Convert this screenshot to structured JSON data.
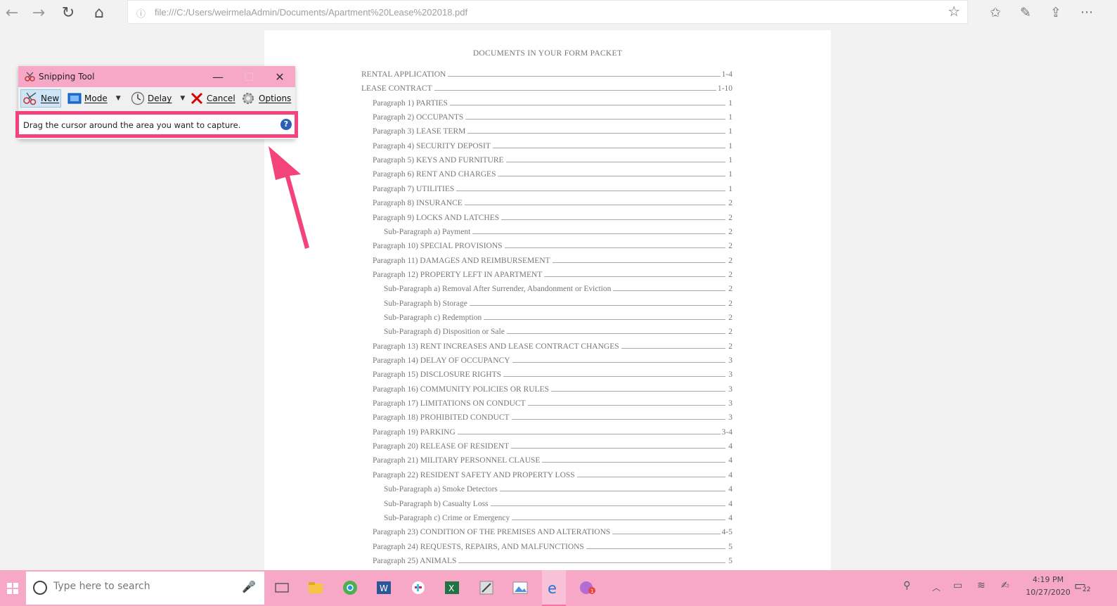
{
  "browser": {
    "back_icon": "←",
    "forward_icon": "→",
    "refresh_icon": "↻",
    "home_icon": "⌂",
    "info_icon": "ⓘ",
    "url": "file:///C:/Users/weirmelaAdmin/Documents/Apartment%20Lease%202018.pdf",
    "favorite_icon": "☆",
    "favorites_icon": "✩",
    "pen_icon": "✎",
    "share_icon": "⇪",
    "more_icon": "···"
  },
  "pdf": {
    "title": "DOCUMENTS IN YOUR FORM PACKET",
    "toc": [
      {
        "label": "RENTAL APPLICATION",
        "page": "1-4",
        "level": 0
      },
      {
        "label": "LEASE CONTRACT",
        "page": "1-10",
        "level": 0
      },
      {
        "label": "Paragraph 1) PARTIES",
        "page": "1",
        "level": 1
      },
      {
        "label": "Paragraph 2) OCCUPANTS",
        "page": "1",
        "level": 1
      },
      {
        "label": "Paragraph 3) LEASE TERM",
        "page": "1",
        "level": 1
      },
      {
        "label": "Paragraph 4) SECURITY DEPOSIT",
        "page": "1",
        "level": 1
      },
      {
        "label": "Paragraph 5) KEYS AND FURNITURE",
        "page": "1",
        "level": 1
      },
      {
        "label": "Paragraph 6) RENT AND CHARGES",
        "page": "1",
        "level": 1
      },
      {
        "label": "Paragraph 7) UTILITIES",
        "page": "1",
        "level": 1
      },
      {
        "label": "Paragraph 8) INSURANCE",
        "page": "2",
        "level": 1
      },
      {
        "label": "Paragraph 9) LOCKS AND LATCHES",
        "page": "2",
        "level": 1
      },
      {
        "label": "Sub-Paragraph a) Payment",
        "page": "2",
        "level": 2
      },
      {
        "label": "Paragraph 10) SPECIAL PROVISIONS",
        "page": "2",
        "level": 1
      },
      {
        "label": "Paragraph 11) DAMAGES AND REIMBURSEMENT",
        "page": "2",
        "level": 1
      },
      {
        "label": "Paragraph 12) PROPERTY LEFT IN APARTMENT",
        "page": "2",
        "level": 1
      },
      {
        "label": "Sub-Paragraph a) Removal After Surrender, Abandonment or Eviction",
        "page": "2",
        "level": 2
      },
      {
        "label": "Sub-Paragraph b) Storage",
        "page": "2",
        "level": 2
      },
      {
        "label": "Sub-Paragraph c) Redemption",
        "page": "2",
        "level": 2
      },
      {
        "label": "Sub-Paragraph d) Disposition or Sale",
        "page": "2",
        "level": 2
      },
      {
        "label": "Paragraph 13) RENT INCREASES AND LEASE CONTRACT CHANGES",
        "page": "2",
        "level": 1
      },
      {
        "label": "Paragraph 14) DELAY OF OCCUPANCY",
        "page": "3",
        "level": 1
      },
      {
        "label": "Paragraph 15) DISCLOSURE RIGHTS",
        "page": "3",
        "level": 1
      },
      {
        "label": "Paragraph 16) COMMUNITY POLICIES OR RULES",
        "page": "3",
        "level": 1
      },
      {
        "label": "Paragraph 17) LIMITATIONS ON CONDUCT",
        "page": "3",
        "level": 1
      },
      {
        "label": "Paragraph 18) PROHIBITED CONDUCT",
        "page": "3",
        "level": 1
      },
      {
        "label": "Paragraph 19) PARKING",
        "page": "3-4",
        "level": 1
      },
      {
        "label": "Paragraph 20) RELEASE OF RESIDENT",
        "page": "4",
        "level": 1
      },
      {
        "label": "Paragraph 21) MILITARY PERSONNEL CLAUSE",
        "page": "4",
        "level": 1
      },
      {
        "label": "Paragraph 22) RESIDENT SAFETY AND PROPERTY LOSS",
        "page": "4",
        "level": 1
      },
      {
        "label": "Sub-Paragraph a) Smoke Detectors",
        "page": "4",
        "level": 2
      },
      {
        "label": "Sub-Paragraph b) Casualty Loss",
        "page": "4",
        "level": 2
      },
      {
        "label": "Sub-Paragraph c) Crime or Emergency",
        "page": "4",
        "level": 2
      },
      {
        "label": "Paragraph 23) CONDITION OF THE PREMISES AND ALTERATIONS",
        "page": "4-5",
        "level": 1
      },
      {
        "label": "Paragraph 24) REQUESTS, REPAIRS, AND MALFUNCTIONS",
        "page": "5",
        "level": 1
      },
      {
        "label": "Paragraph 25) ANIMALS",
        "page": "5",
        "level": 1
      }
    ]
  },
  "snipping_tool": {
    "title": "Snipping Tool",
    "minimize_icon": "—",
    "maximize_icon": "☐",
    "close_icon": "✕",
    "new_label": "New",
    "mode_label": "Mode",
    "delay_label": "Delay",
    "cancel_label": "Cancel",
    "options_label": "Options",
    "dropdown_icon": "▼",
    "message": "Drag the cursor around the area you want to capture.",
    "help_icon": "?"
  },
  "taskbar": {
    "search_placeholder": "Type here to search",
    "mic_icon": "🎤",
    "time": "4:19 PM",
    "date": "10/27/2020",
    "notification_count": "22"
  },
  "colors": {
    "accent_pink": "#f7a8c7",
    "highlight_pink": "#f4427a"
  }
}
